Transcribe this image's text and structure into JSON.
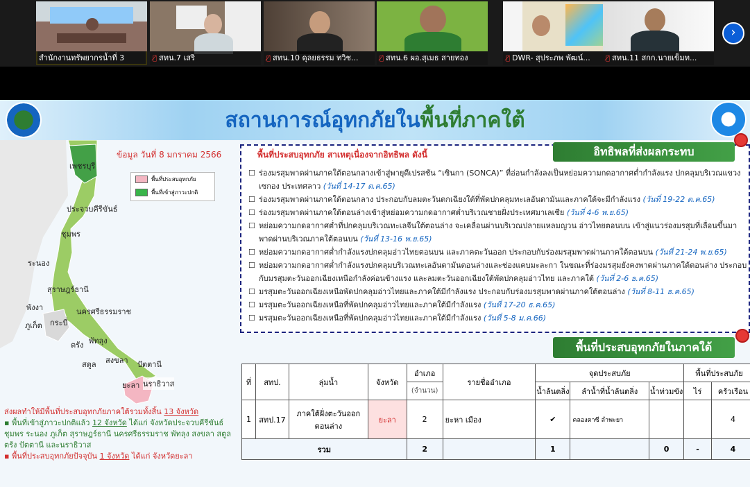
{
  "participants": [
    {
      "name": "สำนักงานทรัพยากรน้ำที่ 3",
      "muted": false,
      "active": true
    },
    {
      "name": "สทน.7 เสริ",
      "muted": true,
      "active": false
    },
    {
      "name": "สทน.10 ดุลยธรรม ทวิช...",
      "muted": true,
      "active": false
    },
    {
      "name": "สทน.6 ผอ.สุเมธ สายทอง",
      "muted": true,
      "active": false
    },
    {
      "name": "DWR- สุประภพ พัฒน์...",
      "muted": true,
      "active": false
    },
    {
      "name": "สทน.11 สกก.นายเข็มท...",
      "muted": true,
      "active": false
    }
  ],
  "next_button": "›",
  "slide": {
    "title_part1": "สถานการณ์อุทกภัยใน",
    "title_part2": "พื้นที่ภาคใต้",
    "map_date": "ข้อมูล วันที่ 8 มกราคม 2566",
    "legend": [
      {
        "label": "พื้นที่ประสบอุทกภัย",
        "color": "#f4b6c2"
      },
      {
        "label": "พื้นที่เข้าสู่ภาวะปกติ",
        "color": "#39b54a"
      }
    ],
    "provinces": {
      "p1": "เพชรบุรี",
      "p2": "ประจวบคีรีขันธ์",
      "p3": "ชุมพร",
      "p4": "ระนอง",
      "p5": "สุราษฎร์ธานี",
      "p6": "พังงา",
      "p7": "นครศรีธรรมราช",
      "p8": "ภูเก็ต",
      "p9": "กระบี่",
      "p10": "พัทลุง",
      "p11": "ตรัง",
      "p12": "สงขลา",
      "p13": "สตูล",
      "p14": "ปัตตานี",
      "p15": "ยะลา",
      "p16": "นราธิวาส"
    },
    "summary": {
      "line1_a": "ส่งผลทำให้มีพื้นที่ประสบอุทกภัยภาคใต้รวมทั้งสิ้น ",
      "line1_b": "13 จังหวัด",
      "line2_a": "▪ พื้นที่เข้าสู่ภาวะปกติแล้ว ",
      "line2_b": "12 จังหวัด",
      "line2_c": " ได้แก่ จังหวัดประจวบคีรีขันธ์ ชุมพร ระนอง ภูเก็ต สุราษฎร์ธานี นครศรีธรรมราช พัทลุง สงขลา สตูล ตรัง ปัตตานี และนราธิวาส",
      "line3_a": "▪ พื้นที่ประสบอุทกภัยปัจจุบัน ",
      "line3_b": "1 จังหวัด",
      "line3_c": " ได้แก่ จังหวัดยะลา"
    },
    "cause_header": "อิทธิพลที่ส่งผลกระทบ",
    "cause_title": "พื้นที่ประสบอุทกภัย สาเหตุเนื่องจากอิทธิพล ดังนี้",
    "causes": [
      {
        "text": "ร่องมรสุมพาดผ่านภาคใต้ตอนกลางเข้าสู่พายุดีเปรสชัน “เซินกา (SONCA)” ที่อ่อนกำลังลงเป็นหย่อมความกดอากาศต่ำกำลังแรง ปกคลุมบริเวณแขวงเซกอง ประเทศลาว ",
        "date": "(วันที่ 14-17 ต.ค.65)"
      },
      {
        "text": "ร่องมรสุมพาดผ่านภาคใต้ตอนกลาง ประกอบกับลมตะวันตกเฉียงใต้ที่พัดปกคลุมทะเลอันดามันและภาคใต้จะมีกำลังแรง ",
        "date": "(วันที่ 19-22 ต.ค.65)"
      },
      {
        "text": "ร่องมรสุมพาดผ่านภาคใต้ตอนล่างเข้าสู่หย่อมความกดอากาศต่ำบริเวณชายฝั่งประเทศมาเลเซีย ",
        "date": "(วันที่ 4-6 พ.ย.65)"
      },
      {
        "text": "หย่อมความกดอากาศต่ำที่ปกคลุมบริเวณทะเลจีนใต้ตอนล่าง จะเคลื่อนผ่านบริเวณปลายแหลมญวน อ่าวไทยตอนบน เข้าสู่แนวร่องมรสุมที่เลื่อนขึ้นมาพาดผ่านบริเวณภาคใต้ตอนบน ",
        "date": "(วันที่ 13-16 พ.ย.65)"
      },
      {
        "text": "หย่อมความกดอากาศต่ำกำลังแรงปกคลุมอ่าวไทยตอนบน และภาคตะวันออก ประกอบกับร่องมรสุมพาดผ่านภาคใต้ตอนบน ",
        "date": "(วันที่ 21-24 พ.ย.65)"
      },
      {
        "text": "หย่อมความกดอากาศต่ำกำลังแรงปกคลุมบริเวณทะเลอันดามันตอนล่างและช่องแคบมะละกา ในขณะที่ร่องมรสุมยังคงพาดผ่านภาคใต้ตอนล่าง ประกอบกับมรสุมตะวันออกเฉียงเหนือกำลังค่อนข้างแรง และลมตะวันออกเฉียงใต้พัดปกคลุมอ่าวไทย และภาคใต้ ",
        "date": "(วันที่ 2-6 ธ.ค.65)"
      },
      {
        "text": "มรสุมตะวันออกเฉียงเหนือพัดปกคลุมอ่าวไทยและภาคใต้มีกำลังแรง ประกอบกับร่องมรสุมพาดผ่านภาคใต้ตอนล่าง ",
        "date": "(วันที่ 8-11 ธ.ค.65)"
      },
      {
        "text": "มรสุมตะวันออกเฉียงเหนือที่พัดปกคลุมอ่าวไทยและภาคใต้มีกำลังแรง ",
        "date": "(วันที่ 17-20 ธ.ค.65)"
      },
      {
        "text": "มรสุมตะวันออกเฉียงเหนือที่พัดปกคลุมอ่าวไทยและภาคใต้มีกำลังแรง ",
        "date": "(วันที่ 5-8 ม.ค.66)"
      }
    ],
    "area_header": "พื้นที่ประสบอุทกภัยในภาคใต้",
    "table": {
      "h_no": "ที่",
      "h_office": "สทป.",
      "h_basin": "ลุ่มน้ำ",
      "h_province": "จังหวัด",
      "h_district": "อำเภอ",
      "h_district_unit": "(จำนวน)",
      "h_district_names": "รายชื่ออำเภอ",
      "h_points": "จุดประสบภัย",
      "h_overflow": "น้ำล้นตลิ่ง",
      "h_river": "ลำน้ำที่น้ำล้นตลิ่ง",
      "h_flood": "น้ำท่วมขัง",
      "h_area": "พื้นที่ประสบภัย",
      "h_rai": "ไร่",
      "h_household": "ครัวเรือน",
      "row_no": "1",
      "row_office": "สทป.17",
      "row_basin": "ภาคใต้ฝั่งตะวันออก ตอนล่าง",
      "row_province": "ยะลา",
      "row_district": "2",
      "row_district_names": "ยะหา เมือง",
      "row_overflow": "✔",
      "row_river": "คลองตาซี ลำพะยา",
      "row_flood": "",
      "row_rai": "",
      "row_household": "4",
      "total_label": "รวม",
      "total_district": "2",
      "total_overflow": "1",
      "total_flood": "0",
      "total_rai": "-",
      "total_household": "4"
    }
  }
}
